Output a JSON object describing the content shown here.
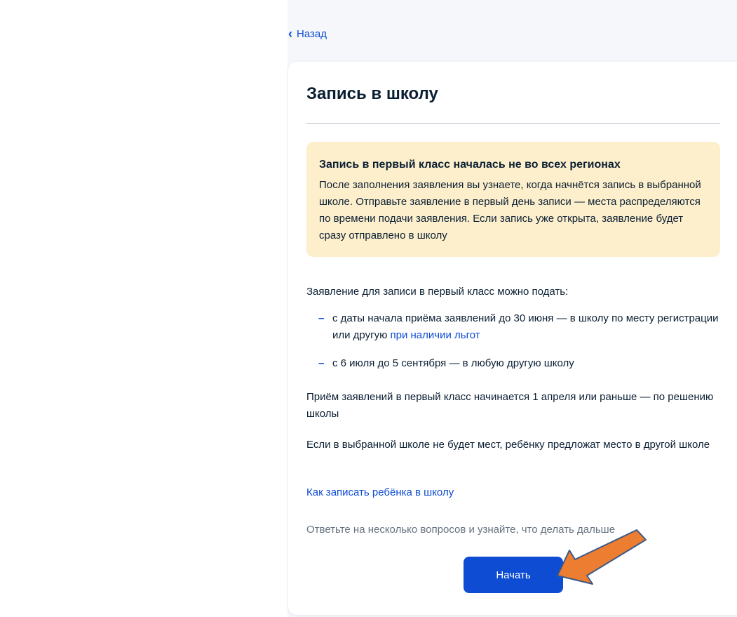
{
  "nav": {
    "back_icon": "‹",
    "back_label": "Назад"
  },
  "card": {
    "title": "Запись в школу"
  },
  "notice": {
    "title": "Запись в первый класс началась не во всех регионах",
    "text": "После заполнения заявления вы узнаете, когда начнётся запись в выбранной школе. Отправьте заявление в первый день записи — места распределяются по времени подачи заявления. Если запись уже открыта, заявление будет сразу отправлено в школу"
  },
  "info": {
    "intro": "Заявление для записи в первый класс можно подать:",
    "bullet_1_text": "с даты начала приёма заявлений до 30 июня — в школу по месту регистрации или другую ",
    "bullet_1_link": "при наличии льгот",
    "bullet_2_text": "с 6 июля до 5 сентября — в любую другую школу",
    "bullet_marker": "–",
    "para_1": "Приём заявлений в первый класс начинается 1 апреля или раньше — по решению школы",
    "para_2": "Если в выбранной школе не будет мест, ребёнку предложат место в другой школе",
    "how_link": "Как записать ребёнка в школу",
    "hint": "Ответьте на несколько вопросов и узнайте, что делать дальше"
  },
  "actions": {
    "start_label": "Начать"
  },
  "colors": {
    "accent": "#0d4cd3",
    "notice_bg": "#fdefcc",
    "annotation_arrow": "#ed7d31"
  },
  "icons": {
    "back": "chevron-left-icon",
    "annotation": "pointer-arrow-icon"
  }
}
